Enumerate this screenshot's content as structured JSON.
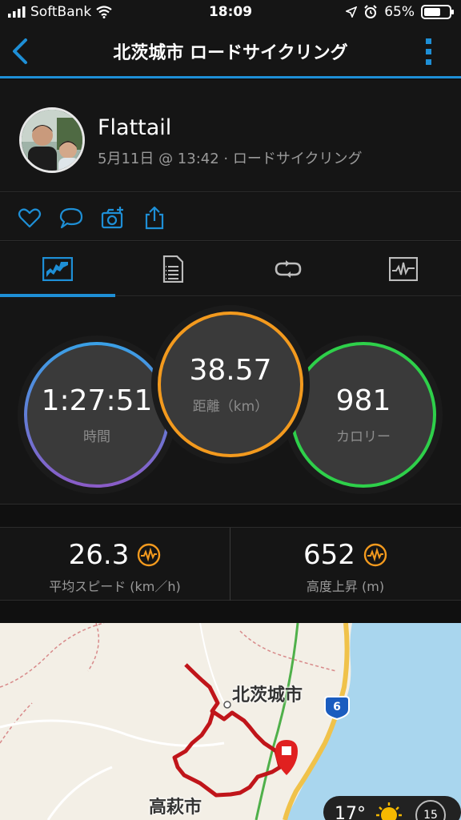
{
  "status_bar": {
    "carrier": "SoftBank",
    "time": "18:09",
    "battery": "65%",
    "battery_level": 0.65
  },
  "nav": {
    "title": "北茨城市 ロードサイクリング",
    "back_icon": "chevron-left-icon",
    "more_icon": "more-vertical-icon",
    "accent": "#1e8fd6"
  },
  "profile": {
    "name": "Flattail",
    "meta": "5月11日 @ 13:42 · ロードサイクリング"
  },
  "actions": [
    "heart-icon",
    "comment-icon",
    "add-photo-icon",
    "share-icon"
  ],
  "tabs": [
    {
      "icon": "overview-chart-icon",
      "active": true
    },
    {
      "icon": "details-list-icon",
      "active": false
    },
    {
      "icon": "laps-loop-icon",
      "active": false
    },
    {
      "icon": "graph-icon",
      "active": false
    }
  ],
  "rings": {
    "time": {
      "value": "1:27:51",
      "label": "時間",
      "color_start": "#3aa0e6",
      "color_end": "#8a5cc7"
    },
    "distance": {
      "value": "38.57",
      "label": "距離（km）",
      "color": "#f39a1e"
    },
    "calories": {
      "value": "981",
      "label": "カロリー",
      "color": "#2ed04a"
    }
  },
  "stats": {
    "avg_speed": {
      "value": "26.3",
      "label": "平均スピード (km／h)"
    },
    "elevation_gain": {
      "value": "652",
      "label": "高度上昇 (m)"
    },
    "badge_color": "#f39a1e"
  },
  "map": {
    "labels": {
      "city1": "北茨城市",
      "city2": "高萩市",
      "route_no": "6"
    },
    "route_color": "#c0151a",
    "sea_color": "#a9d6ee",
    "weather_temp": "17°",
    "weather_badge": "15"
  }
}
